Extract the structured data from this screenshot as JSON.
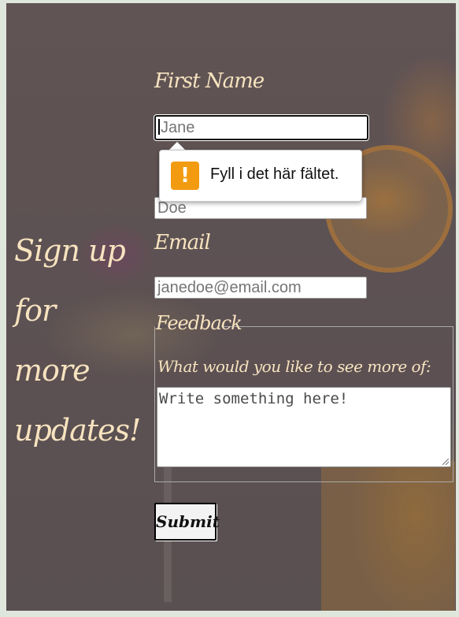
{
  "heading": [
    "Sign up for",
    "more",
    "updates!"
  ],
  "form": {
    "first_name": {
      "label": "First Name",
      "value": "Jane"
    },
    "last_name": {
      "placeholder": "Doe"
    },
    "email": {
      "label": "Email",
      "placeholder": "janedoe@email.com"
    },
    "feedback": {
      "legend": "Feedback",
      "question": "What would you like to see more of:",
      "placeholder": "Write something here!"
    },
    "submit_label": "Submit"
  },
  "validation_tooltip": {
    "icon": "warning-icon",
    "icon_glyph": "!",
    "message": "Fyll i det här fältet."
  },
  "colors": {
    "label_text": "#f7e3bf",
    "warning": "#f29b11"
  }
}
